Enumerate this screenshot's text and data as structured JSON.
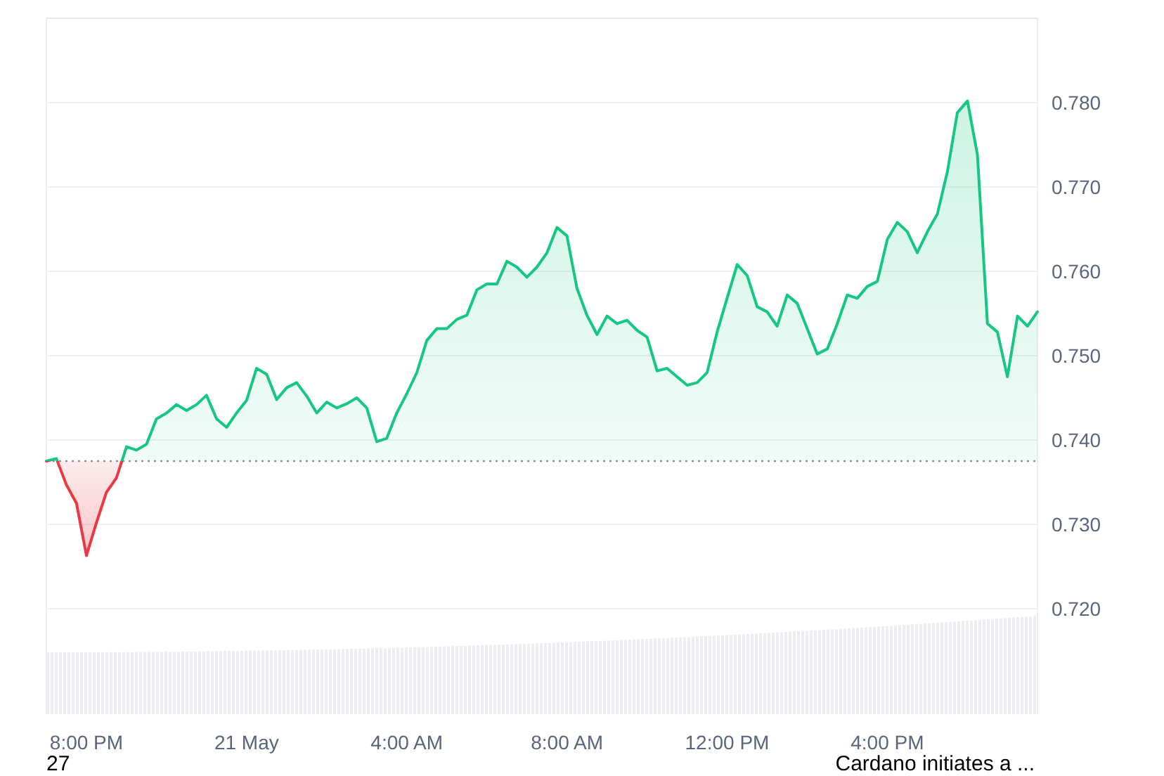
{
  "chart": {
    "chart_data": {
      "type": "area",
      "grid": true,
      "ylim": [
        0.7075,
        0.79
      ],
      "yticks": [
        {
          "value": 0.72,
          "label": "0.720"
        },
        {
          "value": 0.73,
          "label": "0.730"
        },
        {
          "value": 0.74,
          "label": "0.740"
        },
        {
          "value": 0.75,
          "label": "0.750"
        },
        {
          "value": 0.76,
          "label": "0.760"
        },
        {
          "value": 0.77,
          "label": "0.770"
        },
        {
          "value": 0.78,
          "label": "0.780"
        }
      ],
      "categories": [
        null,
        null,
        null,
        null,
        "8:00 PM",
        null,
        null,
        null,
        null,
        null,
        null,
        null,
        null,
        null,
        null,
        null,
        null,
        null,
        null,
        null,
        "21 May",
        null,
        null,
        null,
        null,
        null,
        null,
        null,
        null,
        null,
        null,
        null,
        null,
        null,
        null,
        null,
        "4:00 AM",
        null,
        null,
        null,
        null,
        null,
        null,
        null,
        null,
        null,
        null,
        null,
        null,
        null,
        null,
        null,
        "8:00 AM",
        null,
        null,
        null,
        null,
        null,
        null,
        null,
        null,
        null,
        null,
        null,
        null,
        null,
        null,
        null,
        "12:00 PM",
        null,
        null,
        null,
        null,
        null,
        null,
        null,
        null,
        null,
        null,
        null,
        null,
        null,
        null,
        null,
        "4:00 PM",
        null,
        null,
        null,
        null,
        null,
        null,
        null,
        null,
        null,
        null,
        null,
        null,
        null,
        null,
        null
      ],
      "series": [
        {
          "color": "#16c784",
          "values": [
            0.7375,
            0.7378,
            0.7347,
            0.7325,
            0.7263,
            0.7302,
            0.7338,
            0.7355,
            0.7392,
            0.7388,
            0.7395,
            0.7425,
            0.7432,
            0.7442,
            0.7435,
            0.7442,
            0.7453,
            0.7425,
            0.7415,
            0.7432,
            0.7447,
            0.7485,
            0.7478,
            0.7448,
            0.7462,
            0.7468,
            0.7452,
            0.7432,
            0.7445,
            0.7438,
            0.7443,
            0.745,
            0.7438,
            0.7398,
            0.7402,
            0.7432,
            0.7455,
            0.748,
            0.7518,
            0.7532,
            0.7532,
            0.7543,
            0.7548,
            0.7578,
            0.7585,
            0.7585,
            0.7612,
            0.7605,
            0.7593,
            0.7605,
            0.7622,
            0.7652,
            0.7642,
            0.758,
            0.7548,
            0.7525,
            0.7547,
            0.7538,
            0.7542,
            0.753,
            0.7522,
            0.7482,
            0.7485,
            0.7475,
            0.7465,
            0.7468,
            0.748,
            0.7528,
            0.7568,
            0.7608,
            0.7595,
            0.7558,
            0.7552,
            0.7535,
            0.7572,
            0.7562,
            0.7532,
            0.7502,
            0.7508,
            0.7538,
            0.7572,
            0.7568,
            0.7582,
            0.7588,
            0.7638,
            0.7658,
            0.7647,
            0.7622,
            0.7647,
            0.7668,
            0.7718,
            0.7788,
            0.7802,
            0.7738,
            0.7538,
            0.7528,
            0.7475,
            0.7547,
            0.7535,
            0.7552
          ]
        }
      ]
    }
  },
  "footer": {
    "count": "27",
    "news_snippet": "Cardano initiates a ..."
  }
}
